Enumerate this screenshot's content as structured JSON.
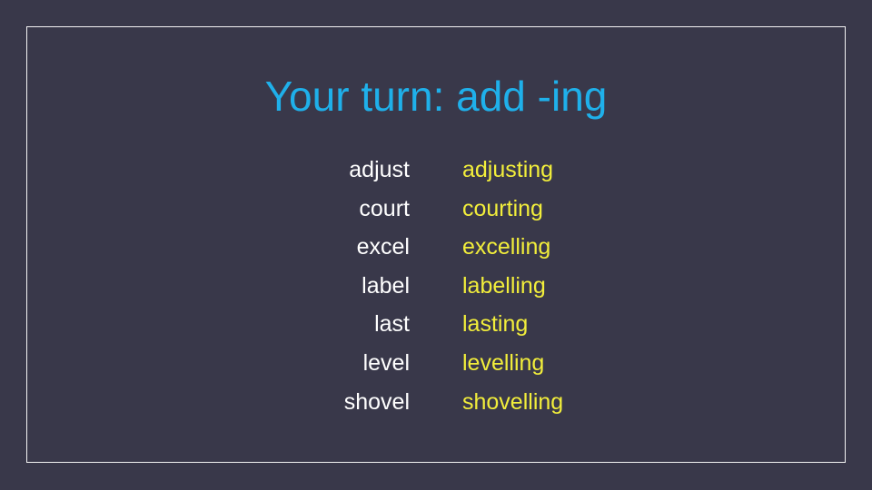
{
  "slide": {
    "title": "Your turn: add -ing",
    "colors": {
      "background": "#39384a",
      "title": "#1fb0ea",
      "base_word": "#ffffff",
      "ing_word": "#f2ee3b",
      "border": "#f4f4f4"
    },
    "words": [
      {
        "base": "adjust",
        "ing": "adjusting"
      },
      {
        "base": "court",
        "ing": "courting"
      },
      {
        "base": "excel",
        "ing": "excelling"
      },
      {
        "base": "label",
        "ing": "labelling"
      },
      {
        "base": "last",
        "ing": "lasting"
      },
      {
        "base": "level",
        "ing": "levelling"
      },
      {
        "base": "shovel",
        "ing": "shovelling"
      }
    ]
  }
}
